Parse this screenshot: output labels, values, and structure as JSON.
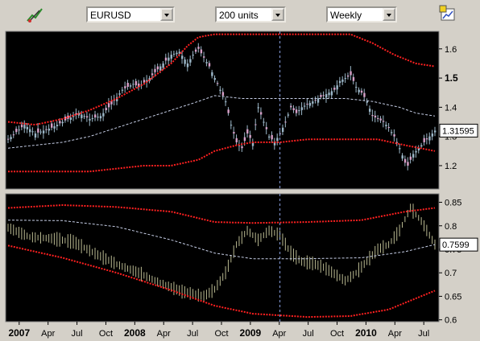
{
  "toolbar": {
    "symbol": "EURUSD",
    "units": "200 units",
    "period": "Weekly",
    "left_icon": "drawing-tools-icon",
    "right_icon": "chart-settings-icon"
  },
  "colors": {
    "panel_bg": "#000000",
    "candle": "#9cb7c8",
    "bands": "#ff2020",
    "mid": "#c8d0e8",
    "osc": "#b8b890",
    "cursor": "#8aa0e0"
  },
  "chart_data": [
    {
      "type": "candlestick",
      "ylim": [
        1.12,
        1.66
      ],
      "yticks": [
        "1.6",
        "1.5",
        "1.4",
        "1.3",
        "1.2"
      ],
      "ytick_values": [
        1.6,
        1.5,
        1.4,
        1.3,
        1.2
      ],
      "last_value": "1.31595",
      "price": [
        [
          0,
          1.29
        ],
        [
          6,
          1.34
        ],
        [
          10,
          1.31
        ],
        [
          16,
          1.33
        ],
        [
          22,
          1.36
        ],
        [
          26,
          1.38
        ],
        [
          30,
          1.36
        ],
        [
          34,
          1.37
        ],
        [
          38,
          1.41
        ],
        [
          42,
          1.46
        ],
        [
          46,
          1.48
        ],
        [
          48,
          1.47
        ],
        [
          52,
          1.5
        ],
        [
          56,
          1.54
        ],
        [
          60,
          1.58
        ],
        [
          63,
          1.59
        ],
        [
          66,
          1.55
        ],
        [
          68,
          1.58
        ],
        [
          70,
          1.6
        ],
        [
          72,
          1.57
        ],
        [
          74,
          1.54
        ],
        [
          76,
          1.5
        ],
        [
          78,
          1.46
        ],
        [
          80,
          1.42
        ],
        [
          82,
          1.34
        ],
        [
          84,
          1.28
        ],
        [
          86,
          1.26
        ],
        [
          88,
          1.31
        ],
        [
          90,
          1.28
        ],
        [
          92,
          1.4
        ],
        [
          94,
          1.35
        ],
        [
          96,
          1.3
        ],
        [
          98,
          1.28
        ],
        [
          100,
          1.31
        ],
        [
          102,
          1.35
        ],
        [
          104,
          1.4
        ],
        [
          106,
          1.38
        ],
        [
          108,
          1.4
        ],
        [
          112,
          1.42
        ],
        [
          116,
          1.44
        ],
        [
          120,
          1.46
        ],
        [
          122,
          1.49
        ],
        [
          124,
          1.5
        ],
        [
          126,
          1.51
        ],
        [
          128,
          1.47
        ],
        [
          130,
          1.45
        ],
        [
          132,
          1.42
        ],
        [
          134,
          1.37
        ],
        [
          136,
          1.36
        ],
        [
          138,
          1.35
        ],
        [
          140,
          1.33
        ],
        [
          142,
          1.3
        ],
        [
          144,
          1.26
        ],
        [
          146,
          1.21
        ],
        [
          147,
          1.2
        ],
        [
          149,
          1.24
        ],
        [
          151,
          1.26
        ],
        [
          153,
          1.28
        ],
        [
          155,
          1.3
        ],
        [
          157,
          1.32
        ]
      ],
      "upper_band": [
        [
          0,
          1.35
        ],
        [
          10,
          1.34
        ],
        [
          20,
          1.36
        ],
        [
          30,
          1.39
        ],
        [
          40,
          1.43
        ],
        [
          50,
          1.48
        ],
        [
          60,
          1.55
        ],
        [
          66,
          1.61
        ],
        [
          70,
          1.64
        ],
        [
          76,
          1.65
        ],
        [
          96,
          1.65
        ],
        [
          110,
          1.65
        ],
        [
          126,
          1.65
        ],
        [
          134,
          1.62
        ],
        [
          142,
          1.58
        ],
        [
          150,
          1.55
        ],
        [
          157,
          1.54
        ]
      ],
      "middle_band": [
        [
          0,
          1.26
        ],
        [
          10,
          1.27
        ],
        [
          20,
          1.28
        ],
        [
          30,
          1.3
        ],
        [
          40,
          1.33
        ],
        [
          50,
          1.36
        ],
        [
          60,
          1.39
        ],
        [
          70,
          1.42
        ],
        [
          76,
          1.44
        ],
        [
          86,
          1.43
        ],
        [
          96,
          1.43
        ],
        [
          110,
          1.43
        ],
        [
          124,
          1.43
        ],
        [
          134,
          1.42
        ],
        [
          144,
          1.4
        ],
        [
          150,
          1.38
        ],
        [
          157,
          1.37
        ]
      ],
      "lower_band": [
        [
          0,
          1.18
        ],
        [
          10,
          1.18
        ],
        [
          20,
          1.18
        ],
        [
          30,
          1.18
        ],
        [
          40,
          1.19
        ],
        [
          50,
          1.2
        ],
        [
          60,
          1.2
        ],
        [
          70,
          1.22
        ],
        [
          76,
          1.25
        ],
        [
          84,
          1.27
        ],
        [
          90,
          1.28
        ],
        [
          100,
          1.28
        ],
        [
          110,
          1.29
        ],
        [
          124,
          1.29
        ],
        [
          136,
          1.29
        ],
        [
          146,
          1.27
        ],
        [
          157,
          1.25
        ]
      ]
    },
    {
      "type": "line",
      "ylim": [
        0.596,
        0.868
      ],
      "yticks": [
        "0.85",
        "0.8",
        "0.75",
        "0.7",
        "0.65",
        "0.6"
      ],
      "ytick_values": [
        0.85,
        0.8,
        0.75,
        0.7,
        0.65,
        0.6
      ],
      "last_value": "0.7599",
      "values": [
        [
          0,
          0.796
        ],
        [
          8,
          0.776
        ],
        [
          16,
          0.773
        ],
        [
          24,
          0.766
        ],
        [
          32,
          0.741
        ],
        [
          40,
          0.718
        ],
        [
          48,
          0.7
        ],
        [
          56,
          0.678
        ],
        [
          64,
          0.66
        ],
        [
          72,
          0.65
        ],
        [
          76,
          0.665
        ],
        [
          80,
          0.7
        ],
        [
          84,
          0.76
        ],
        [
          88,
          0.79
        ],
        [
          92,
          0.77
        ],
        [
          96,
          0.79
        ],
        [
          100,
          0.78
        ],
        [
          104,
          0.742
        ],
        [
          108,
          0.724
        ],
        [
          112,
          0.72
        ],
        [
          116,
          0.712
        ],
        [
          120,
          0.698
        ],
        [
          124,
          0.683
        ],
        [
          128,
          0.7
        ],
        [
          132,
          0.725
        ],
        [
          136,
          0.75
        ],
        [
          140,
          0.76
        ],
        [
          144,
          0.79
        ],
        [
          148,
          0.838
        ],
        [
          152,
          0.81
        ],
        [
          157,
          0.76
        ]
      ],
      "upper_band": [
        [
          0,
          0.838
        ],
        [
          20,
          0.844
        ],
        [
          40,
          0.84
        ],
        [
          60,
          0.83
        ],
        [
          76,
          0.808
        ],
        [
          90,
          0.806
        ],
        [
          110,
          0.808
        ],
        [
          130,
          0.812
        ],
        [
          146,
          0.83
        ],
        [
          157,
          0.838
        ]
      ],
      "middle_band": [
        [
          0,
          0.812
        ],
        [
          20,
          0.811
        ],
        [
          40,
          0.798
        ],
        [
          60,
          0.77
        ],
        [
          76,
          0.742
        ],
        [
          90,
          0.73
        ],
        [
          110,
          0.73
        ],
        [
          130,
          0.732
        ],
        [
          146,
          0.745
        ],
        [
          157,
          0.76
        ]
      ],
      "lower_band": [
        [
          0,
          0.758
        ],
        [
          20,
          0.732
        ],
        [
          40,
          0.7
        ],
        [
          60,
          0.663
        ],
        [
          76,
          0.63
        ],
        [
          90,
          0.613
        ],
        [
          110,
          0.606
        ],
        [
          126,
          0.608
        ],
        [
          140,
          0.622
        ],
        [
          157,
          0.662
        ]
      ]
    }
  ],
  "x_axis": {
    "range": [
      0,
      157
    ],
    "ticks": [
      {
        "w": 5,
        "label": "2007",
        "year": true
      },
      {
        "w": 18,
        "label": "Apr",
        "year": false
      },
      {
        "w": 31,
        "label": "Jul",
        "year": false
      },
      {
        "w": 44,
        "label": "Oct",
        "year": false
      },
      {
        "w": 57,
        "label": "2008",
        "year": true
      },
      {
        "w": 70,
        "label": "Apr",
        "year": false
      },
      {
        "w": 83,
        "label": "Jul",
        "year": false
      },
      {
        "w": 96,
        "label": "Oct",
        "year": false
      },
      {
        "w": 109,
        "label": "2009",
        "year": true
      },
      {
        "w": 122,
        "label": "Apr",
        "year": false
      },
      {
        "w": 135,
        "label": "Jul",
        "year": false
      },
      {
        "w": 148,
        "label": "Oct",
        "year": false
      },
      {
        "w": 161,
        "label": "2010",
        "year": true
      },
      {
        "w": 174,
        "label": "Apr",
        "year": false
      },
      {
        "w": 187,
        "label": "Jul",
        "year": false
      }
    ],
    "cursor_w": 100
  }
}
